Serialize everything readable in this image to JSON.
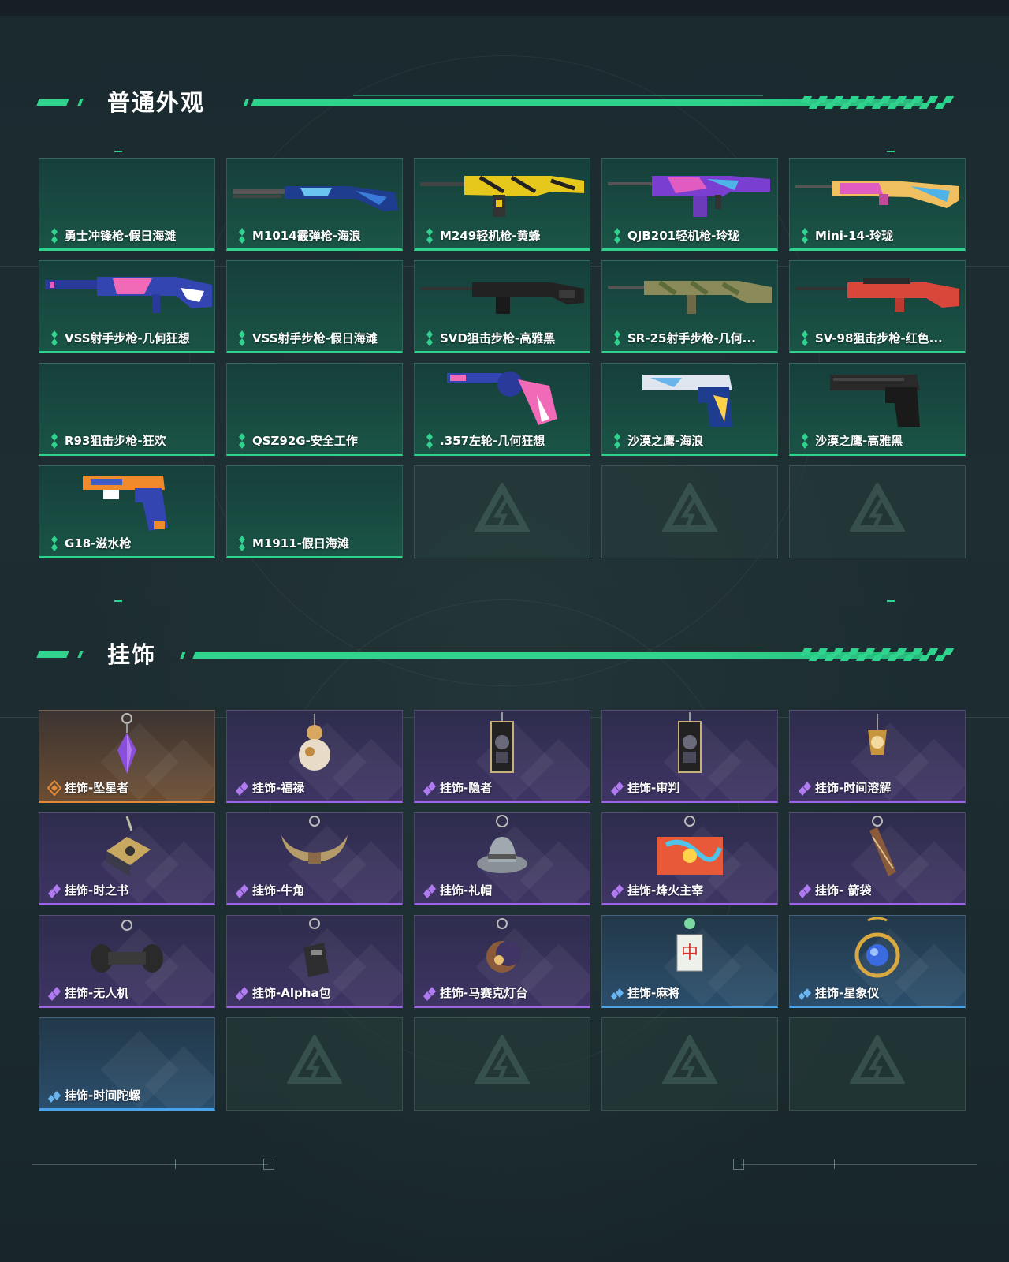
{
  "sections": [
    {
      "title": "普通外观",
      "items": [
        {
          "label": "勇士冲锋枪-假日海滩",
          "rarity": "green",
          "icon": "none"
        },
        {
          "label": "M1014霰弹枪-海浪",
          "rarity": "green",
          "icon": "shotgun-wave"
        },
        {
          "label": "M249轻机枪-黄蜂",
          "rarity": "green",
          "icon": "lmg-yellow"
        },
        {
          "label": "QJB201轻机枪-玲珑",
          "rarity": "green",
          "icon": "lmg-colorful"
        },
        {
          "label": "Mini-14-玲珑",
          "rarity": "green",
          "icon": "rifle-colorful"
        },
        {
          "label": "VSS射手步枪-几何狂想",
          "rarity": "green",
          "icon": "vss-geometric"
        },
        {
          "label": "VSS射手步枪-假日海滩",
          "rarity": "green",
          "icon": "none"
        },
        {
          "label": "SVD狙击步枪-高雅黑",
          "rarity": "green",
          "icon": "sniper-black"
        },
        {
          "label": "SR-25射手步枪-几何...",
          "rarity": "green",
          "icon": "rifle-camo"
        },
        {
          "label": "SV-98狙击步枪-红色...",
          "rarity": "green",
          "icon": "sniper-red"
        },
        {
          "label": "R93狙击步枪-狂欢",
          "rarity": "green",
          "icon": "none"
        },
        {
          "label": "QSZ92G-安全工作",
          "rarity": "green",
          "icon": "none"
        },
        {
          "label": ".357左轮-几何狂想",
          "rarity": "green",
          "icon": "revolver-geometric"
        },
        {
          "label": "沙漠之鹰-海浪",
          "rarity": "green",
          "icon": "pistol-wave"
        },
        {
          "label": "沙漠之鹰-高雅黑",
          "rarity": "green",
          "icon": "pistol-black"
        },
        {
          "label": "G18-滋水枪",
          "rarity": "green",
          "icon": "pistol-water"
        },
        {
          "label": "M1911-假日海滩",
          "rarity": "green",
          "icon": "none"
        }
      ],
      "empty_slots": 3
    },
    {
      "title": "挂饰",
      "items": [
        {
          "label": "挂饰-坠星者",
          "rarity": "orange",
          "icon": "charm-crystal"
        },
        {
          "label": "挂饰-福禄",
          "rarity": "purple",
          "icon": "charm-gourd"
        },
        {
          "label": "挂饰-隐者",
          "rarity": "purple",
          "icon": "charm-card"
        },
        {
          "label": "挂饰-审判",
          "rarity": "purple",
          "icon": "charm-card"
        },
        {
          "label": "挂饰-时间溶解",
          "rarity": "purple",
          "icon": "charm-clock"
        },
        {
          "label": "挂饰-时之书",
          "rarity": "purple",
          "icon": "charm-book"
        },
        {
          "label": "挂饰-牛角",
          "rarity": "purple",
          "icon": "charm-horns"
        },
        {
          "label": "挂饰-礼帽",
          "rarity": "purple",
          "icon": "charm-hat"
        },
        {
          "label": "挂饰-烽火主宰",
          "rarity": "purple",
          "icon": "charm-container"
        },
        {
          "label": "挂饰- 箭袋",
          "rarity": "purple",
          "icon": "charm-quiver"
        },
        {
          "label": "挂饰-无人机",
          "rarity": "purple",
          "icon": "charm-drone"
        },
        {
          "label": "挂饰-Alpha包",
          "rarity": "purple",
          "icon": "charm-bag"
        },
        {
          "label": "挂饰-马赛克灯台",
          "rarity": "purple",
          "icon": "charm-moon"
        },
        {
          "label": "挂饰-麻将",
          "rarity": "blue",
          "icon": "charm-mahjong"
        },
        {
          "label": "挂饰-星象仪",
          "rarity": "blue",
          "icon": "charm-orb"
        },
        {
          "label": "挂饰-时间陀螺",
          "rarity": "blue",
          "icon": "none"
        }
      ],
      "empty_slots": 4
    }
  ],
  "colors": {
    "accent": "#2fd38d",
    "green_bottom": "#2fd38d",
    "purple_bottom": "#9a66e6",
    "orange_bottom": "#e08a3a",
    "blue_bottom": "#4aa3e8"
  }
}
